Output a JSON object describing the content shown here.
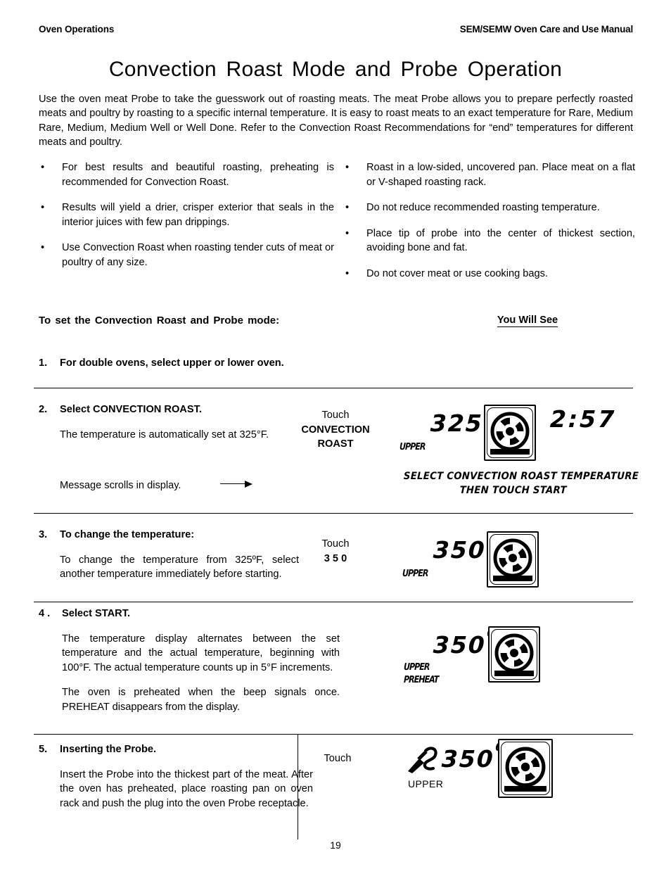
{
  "header": {
    "left": "Oven Operations",
    "right": "SEM/SEMW Oven Care and Use Manual"
  },
  "title": "Convection Roast Mode and Probe Operation",
  "intro": "Use the oven meat Probe to take the guesswork out of roasting meats.  The meat Probe allows you to prepare perfectly roasted meats and poultry by roasting to a specific internal temperature. It is easy to roast meats to an exact temperature for Rare, Medium Rare, Medium, Medium Well or Well Done. Refer to the Convection Roast Recommendations for “end” temperatures for different meats and poultry.",
  "bullet_marker": "•",
  "bullets_left": [
    "For best results and beautiful roasting, preheating is recommended for Convection Roast.",
    "Results will yield a drier, crisper exterior that seals in the interior juices with few pan drippings.",
    "Use Convection Roast when roasting tender cuts of meat or poultry of any size."
  ],
  "bullets_right": [
    "Roast in a low-sided, uncovered pan. Place meat on a flat or V-shaped roasting rack.",
    "Do not reduce recommended roasting temperature.",
    "Place tip of probe into the center of thickest section, avoiding bone and fat.",
    "Do not cover meat or use cooking bags."
  ],
  "section": {
    "set_heading": "To set the Convection Roast  and  Probe mode:",
    "you_will_see": "You Will See"
  },
  "steps": [
    {
      "number": "1.",
      "title": "For double ovens, select upper or lower oven.",
      "body": ""
    },
    {
      "number": "2.",
      "title": "Select CONVECTION ROAST.",
      "body": "The temperature is automatically set at 325°F.",
      "note": "Message scrolls in display.",
      "touch_label": "Touch",
      "touch_keys": "CONVECTION ROAST",
      "display": {
        "temperature": "325",
        "degree": "0",
        "clock": "2:57",
        "annunciators": [
          "UPPER"
        ],
        "scroll_line1": "SELECT CONVECTION ROAST TEMPERATURE",
        "scroll_line2": "THEN TOUCH START"
      }
    },
    {
      "number": "3.",
      "title": "To change the temperature:",
      "body": "To change the temperature from 325ºF, select another temperature immediately before starting.",
      "touch_label": "Touch",
      "touch_keys": "3  5  0",
      "display": {
        "temperature": "350",
        "degree": "0",
        "annunciators": [
          "UPPER"
        ]
      }
    },
    {
      "number": "4 .",
      "title": "Select START.",
      "body": "The temperature display alternates between the set temperature and the actual temperature, beginning with 100°F.  The actual temperature counts up in 5°F increments.",
      "body2": "The oven is preheated when the beep signals once. PREHEAT disappears from the display.",
      "display": {
        "temperature": "350",
        "degree": "0",
        "annunciators": [
          "UPPER",
          "PREHEAT"
        ]
      }
    },
    {
      "number": "5.",
      "title": "Inserting the Probe.",
      "body": "Insert the Probe into the thickest part of the meat. After the oven has preheated, place roasting pan on oven rack and push the plug into the oven Probe receptacle.",
      "touch_label": "Touch",
      "display": {
        "temperature": "350",
        "degree": "0",
        "annunciators": [
          "UPPER"
        ],
        "probe_icon": true
      }
    }
  ],
  "folio": "19",
  "colors": {
    "ink": "#000000",
    "paper": "#ffffff"
  }
}
